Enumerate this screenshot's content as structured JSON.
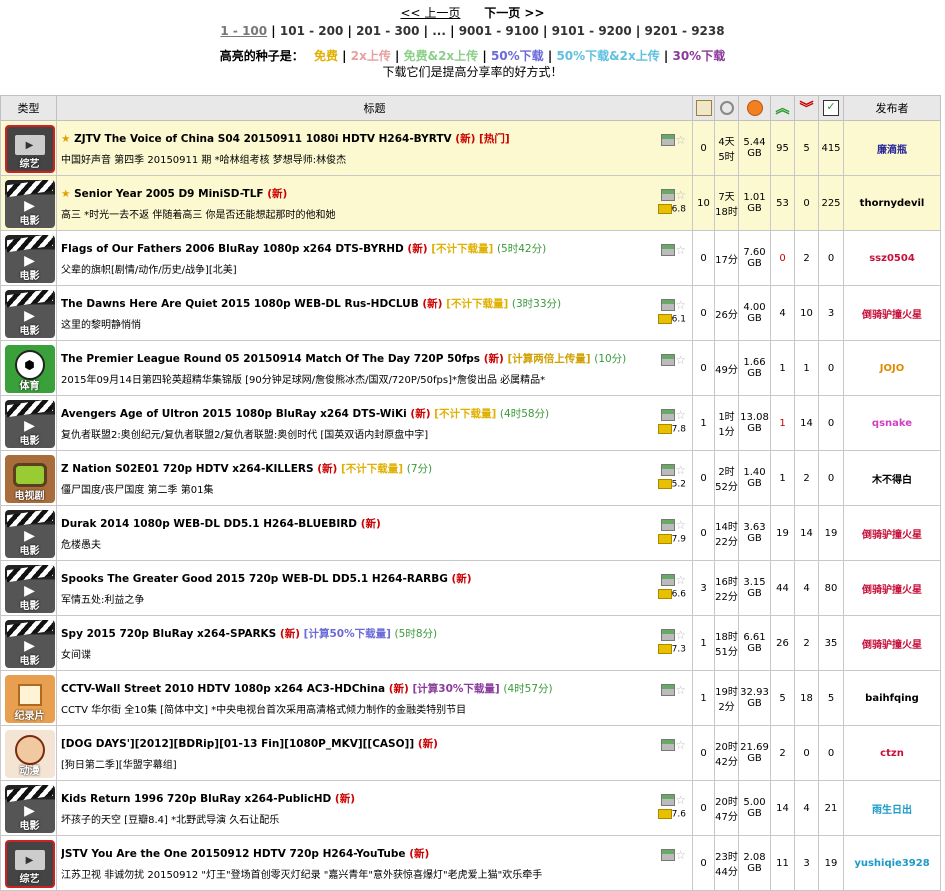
{
  "pager": {
    "prev": "<< 上一页",
    "next": "下一页 >>",
    "pages": [
      "1 - 100",
      "101 - 200",
      "201 - 300",
      "...",
      "9001 - 9100",
      "9101 - 9200",
      "9201 - 9238"
    ]
  },
  "legend": {
    "label": "高亮的种子是：",
    "items": [
      {
        "text": "免费",
        "color": "#e0b000"
      },
      {
        "text": "2x上传",
        "color": "#e8a0a0"
      },
      {
        "text": "免费&2x上传",
        "color": "#8ad08a"
      },
      {
        "text": "50%下载",
        "color": "#6a6ad8"
      },
      {
        "text": "50%下载&2x上传",
        "color": "#60c0e0"
      },
      {
        "text": "30%下载",
        "color": "#8a3a9a"
      }
    ],
    "tagline": "下载它们是提高分享率的好方式！"
  },
  "table": {
    "headers": {
      "type": "类型",
      "title": "标题",
      "uploader": "发布者"
    },
    "rows": [
      {
        "cat": "variety",
        "cat_label": "综艺",
        "sticky": true,
        "star": "★",
        "name": "ZJTV The Voice of China S04 20150911 1080i HDTV H264-BYRTV",
        "new": "(新)",
        "hot": "[热门]",
        "promo": "",
        "promo_class": "",
        "time_left": "",
        "sub": "中国好声音 第四季 20150911 期 *哈林组考核 梦想导师:林俊杰",
        "imdb": "",
        "comments": "0",
        "age": "4天 5时",
        "size": "5.44 GB",
        "seeders": "95",
        "seed_red": false,
        "leechers": "5",
        "completed": "415",
        "uploader": "廉滴瓶",
        "uploader_color": "#2a2a9a"
      },
      {
        "cat": "movie",
        "cat_label": "电影",
        "sticky": true,
        "star": "★",
        "name": "Senior Year 2005 D9 MiniSD-TLF",
        "new": "(新)",
        "hot": "",
        "promo": "",
        "promo_class": "",
        "time_left": "",
        "sub": "高三 *时光一去不返 伴随着高三 你是否还能想起那时的他和她",
        "imdb": "6.8",
        "comments": "10",
        "age": "7天 18时",
        "size": "1.01 GB",
        "seeders": "53",
        "seed_red": false,
        "leechers": "0",
        "completed": "225",
        "uploader": "thornydevil",
        "uploader_color": "#000000"
      },
      {
        "cat": "movie",
        "cat_label": "电影",
        "sticky": false,
        "star": "",
        "name": "Flags of Our Fathers 2006 BluRay 1080p x264 DTS-BYRHD",
        "new": "(新)",
        "hot": "",
        "promo": "[不计下载量]",
        "promo_class": "promo-free",
        "time_left": "(5时42分)",
        "sub": "父辈的旗帜[剧情/动作/历史/战争][北美]",
        "imdb": "",
        "comments": "0",
        "age": "17分",
        "size": "7.60 GB",
        "seeders": "0",
        "seed_red": true,
        "leechers": "2",
        "completed": "0",
        "uploader": "ssz0504",
        "uploader_color": "#c8103a"
      },
      {
        "cat": "movie",
        "cat_label": "电影",
        "sticky": false,
        "star": "",
        "name": "The Dawns Here Are Quiet 2015 1080p WEB-DL Rus-HDCLUB",
        "new": "(新)",
        "hot": "",
        "promo": "[不计下载量]",
        "promo_class": "promo-free",
        "time_left": "(3时33分)",
        "sub": "这里的黎明静悄悄",
        "imdb": "6.1",
        "comments": "0",
        "age": "26分",
        "size": "4.00 GB",
        "seeders": "4",
        "seed_red": false,
        "leechers": "10",
        "completed": "3",
        "uploader": "倒骑驴撞火星",
        "uploader_color": "#c8103a"
      },
      {
        "cat": "sport",
        "cat_label": "体育",
        "sticky": false,
        "star": "",
        "name": "The Premier League Round 05 20150914 Match Of The Day 720P 50fps",
        "new": "(新)",
        "hot": "",
        "promo": "[计算两倍上传量]",
        "promo_class": "promo-2x",
        "time_left": "(10分)",
        "sub": "2015年09月14日第四轮英超精华集锦版 [90分钟足球网/詹俊熊冰杰/国双/720P/50fps]*詹俊出品 必属精品*",
        "imdb": "",
        "comments": "0",
        "age": "49分",
        "size": "1.66 GB",
        "seeders": "1",
        "seed_red": false,
        "leechers": "1",
        "completed": "0",
        "uploader": "JOJO",
        "uploader_color": "#e08a00"
      },
      {
        "cat": "movie",
        "cat_label": "电影",
        "sticky": false,
        "star": "",
        "name": "Avengers Age of Ultron 2015 1080p BluRay x264 DTS-WiKi",
        "new": "(新)",
        "hot": "",
        "promo": "[不计下载量]",
        "promo_class": "promo-free",
        "time_left": "(4时58分)",
        "sub": "复仇者联盟2:奥创纪元/复仇者联盟2/复仇者联盟:奥创时代 [国英双语内封原盘中字]",
        "imdb": "7.8",
        "comments": "1",
        "age": "1时 1分",
        "size": "13.08 GB",
        "seeders": "1",
        "seed_red": true,
        "leechers": "14",
        "completed": "0",
        "uploader": "qsnake",
        "uploader_color": "#d040c0"
      },
      {
        "cat": "drama",
        "cat_label": "电视剧",
        "sticky": false,
        "star": "",
        "name": "Z Nation S02E01 720p HDTV x264-KILLERS",
        "new": "(新)",
        "hot": "",
        "promo": "[不计下载量]",
        "promo_class": "promo-free",
        "time_left": "(7分)",
        "sub": "僵尸国度/丧尸国度 第二季 第01集",
        "imdb": "5.2",
        "comments": "0",
        "age": "2时 52分",
        "size": "1.40 GB",
        "seeders": "1",
        "seed_red": false,
        "leechers": "2",
        "completed": "0",
        "uploader": "木不得白",
        "uploader_color": "#000000"
      },
      {
        "cat": "movie",
        "cat_label": "电影",
        "sticky": false,
        "star": "",
        "name": "Durak 2014 1080p WEB-DL DD5.1 H264-BLUEBIRD",
        "new": "(新)",
        "hot": "",
        "promo": "",
        "promo_class": "",
        "time_left": "",
        "sub": "危楼愚夫",
        "imdb": "7.9",
        "comments": "0",
        "age": "14时 22分",
        "size": "3.63 GB",
        "seeders": "19",
        "seed_red": false,
        "leechers": "14",
        "completed": "19",
        "uploader": "倒骑驴撞火星",
        "uploader_color": "#c8103a"
      },
      {
        "cat": "movie",
        "cat_label": "电影",
        "sticky": false,
        "star": "",
        "name": "Spooks The Greater Good 2015 720p WEB-DL DD5.1 H264-RARBG",
        "new": "(新)",
        "hot": "",
        "promo": "",
        "promo_class": "",
        "time_left": "",
        "sub": "军情五处:利益之争",
        "imdb": "6.6",
        "comments": "3",
        "age": "16时 22分",
        "size": "3.15 GB",
        "seeders": "44",
        "seed_red": false,
        "leechers": "4",
        "completed": "80",
        "uploader": "倒骑驴撞火星",
        "uploader_color": "#c8103a"
      },
      {
        "cat": "movie",
        "cat_label": "电影",
        "sticky": false,
        "star": "",
        "name": "Spy 2015 720p BluRay x264-SPARKS",
        "new": "(新)",
        "hot": "",
        "promo": "[计算50%下载量]",
        "promo_class": "promo-50",
        "time_left": "(5时8分)",
        "sub": "女间谍",
        "imdb": "7.3",
        "comments": "1",
        "age": "18时 51分",
        "size": "6.61 GB",
        "seeders": "26",
        "seed_red": false,
        "leechers": "2",
        "completed": "35",
        "uploader": "倒骑驴撞火星",
        "uploader_color": "#c8103a"
      },
      {
        "cat": "doc",
        "cat_label": "纪录片",
        "sticky": false,
        "star": "",
        "name": "CCTV-Wall Street 2010 HDTV 1080p x264 AC3-HDChina",
        "new": "(新)",
        "hot": "",
        "promo": "[计算30%下载量]",
        "promo_class": "promo-30",
        "time_left": "(4时57分)",
        "sub": "CCTV 华尔街 全10集 [简体中文] *中央电视台首次采用高清格式倾力制作的金融类特别节目",
        "imdb": "",
        "comments": "1",
        "age": "19时 2分",
        "size": "32.93 GB",
        "seeders": "5",
        "seed_red": false,
        "leechers": "18",
        "completed": "5",
        "uploader": "baihfqing",
        "uploader_color": "#000000"
      },
      {
        "cat": "anime",
        "cat_label": "动漫",
        "sticky": false,
        "star": "",
        "name": "[DOG DAYS'][2012][BDRip][01-13 Fin][1080P_MKV][[CASO]]",
        "new": "(新)",
        "hot": "",
        "promo": "",
        "promo_class": "",
        "time_left": "",
        "sub": "[狗日第二季][华盟字幕组]",
        "imdb": "",
        "comments": "0",
        "age": "20时 42分",
        "size": "21.69 GB",
        "seeders": "2",
        "seed_red": false,
        "leechers": "0",
        "completed": "0",
        "uploader": "ctzn",
        "uploader_color": "#c8103a"
      },
      {
        "cat": "movie",
        "cat_label": "电影",
        "sticky": false,
        "star": "",
        "name": "Kids Return 1996 720p BluRay x264-PublicHD",
        "new": "(新)",
        "hot": "",
        "promo": "",
        "promo_class": "",
        "time_left": "",
        "sub": "坏孩子的天空 [豆瓣8.4] *北野武导演 久石让配乐",
        "imdb": "7.6",
        "comments": "0",
        "age": "20时 47分",
        "size": "5.00 GB",
        "seeders": "14",
        "seed_red": false,
        "leechers": "4",
        "completed": "21",
        "uploader": "雨生日出",
        "uploader_color": "#1a9ac8"
      },
      {
        "cat": "variety",
        "cat_label": "综艺",
        "sticky": false,
        "star": "",
        "name": "JSTV You Are the One 20150912 HDTV 720p H264-YouTube",
        "new": "(新)",
        "hot": "",
        "promo": "",
        "promo_class": "",
        "time_left": "",
        "sub": "江苏卫视 非诚勿扰 20150912 \"灯王\"登场首创零灭灯纪录 \"嘉兴青年\"意外获惊喜爆灯\"老虎爱上猫\"欢乐牵手",
        "imdb": "",
        "comments": "0",
        "age": "23时 44分",
        "size": "2.08 GB",
        "seeders": "11",
        "seed_red": false,
        "leechers": "3",
        "completed": "19",
        "uploader": "yushiqie3928",
        "uploader_color": "#1a9ac8"
      }
    ]
  }
}
